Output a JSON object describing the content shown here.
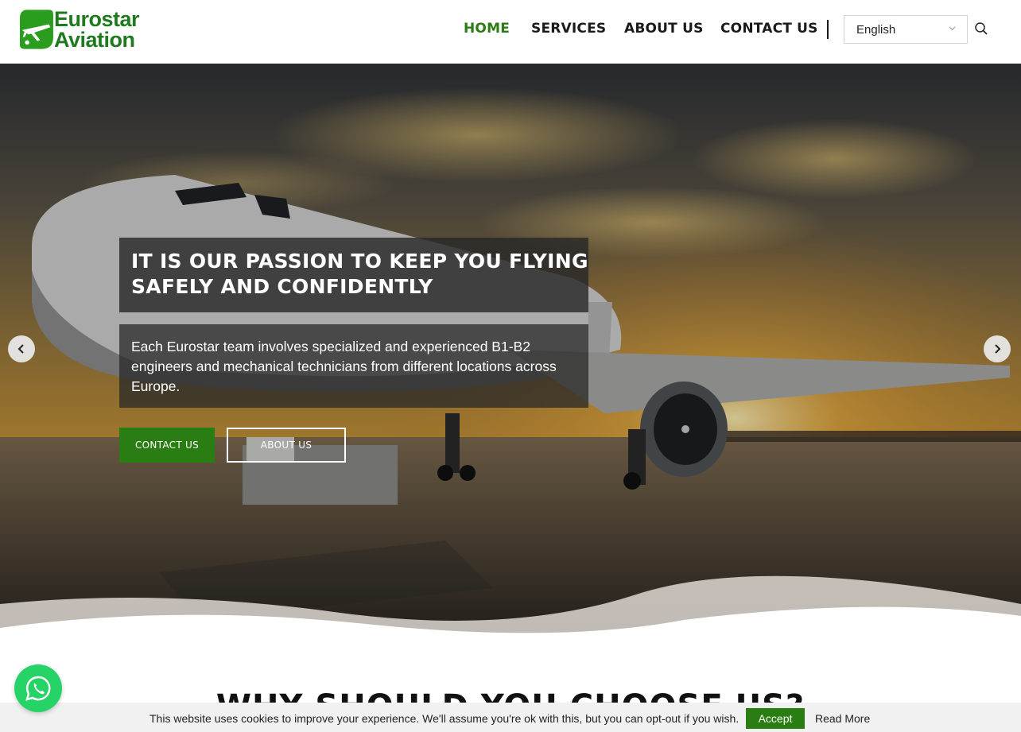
{
  "brand": {
    "name_line1": "Eurostar",
    "name_line2": "Aviation",
    "color": "#2a7d12"
  },
  "nav": {
    "items": [
      {
        "label": "HOME",
        "active": true
      },
      {
        "label": "SERVICES",
        "active": false
      },
      {
        "label": "ABOUT US",
        "active": false
      },
      {
        "label": "CONTACT US",
        "active": false
      }
    ],
    "language": "English",
    "search_icon": "search-icon"
  },
  "hero": {
    "headline": "IT IS OUR PASSION TO KEEP YOU FLYING SAFELY AND CONFIDENTLY",
    "description": "Each Eurostar team involves specialized and experienced B1-B2 engineers and mechanical technicians from different locations across Europe.",
    "primary_button": "CONTACT US",
    "secondary_button": "ABOUT US",
    "prev_icon": "chevron-left-icon",
    "next_icon": "chevron-right-icon"
  },
  "section": {
    "title": "WHY SHOULD YOU CHOOSE US?"
  },
  "cookie": {
    "message": "This website uses cookies to improve your experience. We'll assume you're ok with this, but you can opt-out if you wish.",
    "accept": "Accept",
    "read_more": "Read More"
  },
  "colors": {
    "accent": "#2a7d12",
    "whatsapp": "#25d366"
  }
}
